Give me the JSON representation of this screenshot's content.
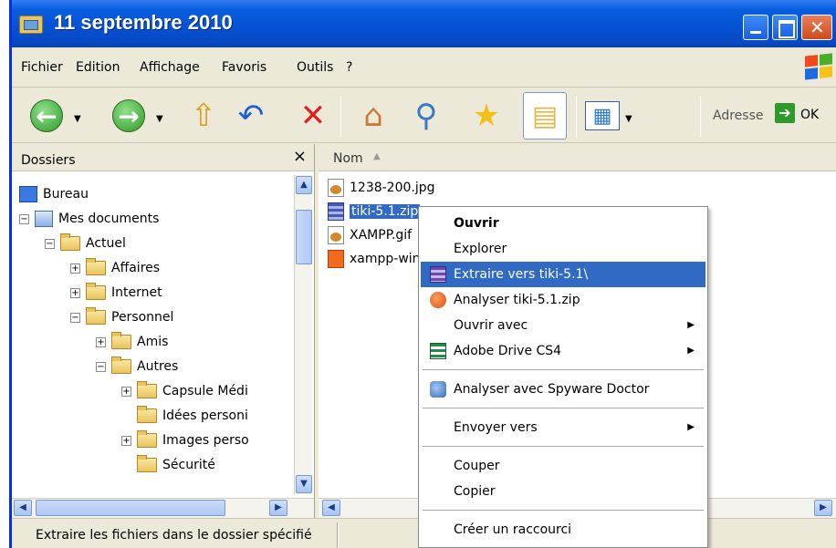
{
  "window": {
    "title": "11 septembre 2010"
  },
  "menubar": {
    "items": [
      "Fichier",
      "Edition",
      "Affichage",
      "Favoris",
      "Outils",
      "?"
    ]
  },
  "toolbar": {
    "address_label": "Adresse",
    "ok_label": "OK"
  },
  "folders_pane": {
    "header": "Dossiers",
    "close_glyph": "×",
    "tree": [
      {
        "label": "Bureau",
        "icon": "desktop-icon",
        "expander": ""
      },
      {
        "label": "Mes documents",
        "icon": "documents-icon",
        "expander": "−"
      },
      {
        "label": "Actuel",
        "icon": "folder-icon",
        "expander": "−"
      },
      {
        "label": "Affaires",
        "icon": "folder-icon",
        "expander": "+"
      },
      {
        "label": "Internet",
        "icon": "folder-icon",
        "expander": "+"
      },
      {
        "label": "Personnel",
        "icon": "folder-icon",
        "expander": "−"
      },
      {
        "label": "Amis",
        "icon": "folder-icon",
        "expander": "+"
      },
      {
        "label": "Autres",
        "icon": "folder-icon",
        "expander": "−"
      },
      {
        "label": "Capsule Médi",
        "icon": "folder-icon",
        "expander": "+"
      },
      {
        "label": "Idées personi",
        "icon": "folder-icon",
        "expander": ""
      },
      {
        "label": "Images perso",
        "icon": "folder-icon",
        "expander": "+"
      },
      {
        "label": "Sécurité",
        "icon": "folder-icon",
        "expander": ""
      }
    ]
  },
  "files_pane": {
    "column_name": "Nom",
    "files": [
      {
        "name": "1238-200.jpg",
        "icon": "image-file-icon",
        "selected": false
      },
      {
        "name": "tiki-5.1.zip",
        "icon": "zip-file-icon",
        "selected": true
      },
      {
        "name": "XAMPP.gif",
        "icon": "image-file-icon",
        "selected": false
      },
      {
        "name": "xampp-win",
        "icon": "xampp-file-icon",
        "selected": false
      }
    ]
  },
  "context_menu": {
    "items": [
      {
        "label": "Ouvrir"
      },
      {
        "label": "Explorer"
      },
      {
        "label": "Extraire vers tiki-5.1\\"
      },
      {
        "label": "Analyser tiki-5.1.zip"
      },
      {
        "label": "Ouvrir avec"
      },
      {
        "label": "Adobe Drive CS4"
      },
      {
        "label": "Analyser avec Spyware Doctor"
      },
      {
        "label": "Envoyer vers"
      },
      {
        "label": "Couper"
      },
      {
        "label": "Copier"
      },
      {
        "label": "Créer un raccourci"
      }
    ]
  },
  "statusbar": {
    "text": "Extraire les fichiers dans le dossier spécifié"
  },
  "colors": {
    "titlebar": "#0551d4",
    "selection": "#316AC5",
    "chrome": "#ECE9D8"
  }
}
